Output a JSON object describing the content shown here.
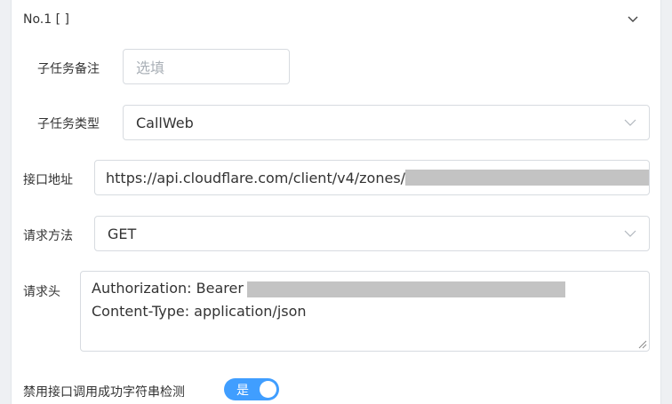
{
  "section": {
    "title": "No.1 [ ]",
    "collapse_icon": "chevron-down-icon"
  },
  "fields": {
    "note": {
      "label": "子任务备注",
      "placeholder": "选填",
      "value": ""
    },
    "task_type": {
      "label": "子任务类型",
      "value": "CallWeb"
    },
    "url": {
      "label": "接口地址",
      "value": "https://api.cloudflare.com/client/v4/zones/"
    },
    "method": {
      "label": "请求方法",
      "value": "GET"
    },
    "headers": {
      "label": "请求头",
      "line1": "Authorization: Bearer",
      "line2": "Content-Type: application/json"
    },
    "disable_check": {
      "label": "禁用接口调用成功字符串检测",
      "toggle_label": "是",
      "enabled": true
    }
  },
  "colors": {
    "accent": "#409eff",
    "border": "#d7dbe0",
    "redaction": "#c3c3c3"
  }
}
